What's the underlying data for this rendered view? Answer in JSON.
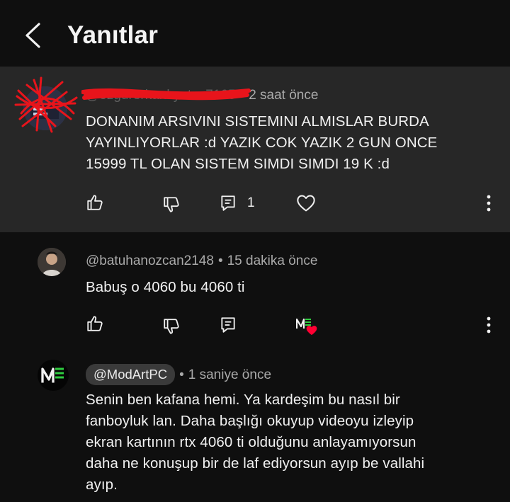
{
  "header": {
    "title": "Yanıtlar"
  },
  "parent_comment": {
    "handle": "@ozgurerkankyatos7165",
    "time": "2 saat önce",
    "lines": [
      "DONANIM ARSIVINI SISTEMINI ALMISLAR BURDA",
      "YAYINLIYORLAR :d YAZIK COK YAZIK 2 GUN ONCE",
      "15999 TL OLAN SISTEM SIMDI  SIMDI 19 K :d"
    ],
    "reply_count": "1"
  },
  "reply_1": {
    "handle": "@batuhanozcan2148",
    "time": "15 dakika önce",
    "text": "Babuş o 4060 bu 4060 ti"
  },
  "reply_2": {
    "handle": "@ModArtPC",
    "time": "1 saniye önce",
    "lines": [
      "Senin ben kafana hemi. Ya kardeşim bu nasıl bir",
      "fanboyluk lan. Daha başlığı okuyup videoyu izleyip",
      "ekran kartının rtx 4060 ti olduğunu anlayamıyorsun",
      "daha ne konuşup bir de laf ediyorsun ayıp be vallahi",
      "ayıp."
    ]
  },
  "colors": {
    "background": "#0f0f0f",
    "highlight": "#272727",
    "text": "#f1f1f1",
    "muted": "#aaaaaa",
    "redaction": "#e8141b",
    "heart": "#ff0033",
    "logo_green": "#2ecc40"
  },
  "icons": [
    "back-arrow-icon",
    "like-icon",
    "dislike-icon",
    "reply-icon",
    "heart-icon",
    "more-vert-icon",
    "creator-heart-icon"
  ]
}
